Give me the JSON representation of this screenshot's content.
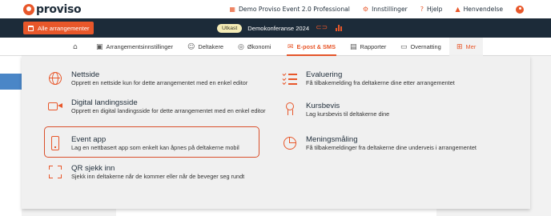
{
  "brand": {
    "name": "proviso",
    "accent": "#e8572a",
    "dark": "#1c2b39"
  },
  "topbar": {
    "product": "Demo Proviso Event 2.0 Professional",
    "settings": "Innstillinger",
    "help": "Hjelp",
    "notifications": "Henvendelse"
  },
  "eventbar": {
    "all_events": "Alle arrangementer",
    "status": "Utkast",
    "event_name": "Demokonferanse 2024"
  },
  "nav": {
    "home": "",
    "event_settings": "Arrangementsinnstillinger",
    "participants": "Deltakere",
    "economy": "Økonomi",
    "email_sms": "E-post & SMS",
    "reports": "Rapporter",
    "overnight": "Overnatting",
    "more": "Mer"
  },
  "menu": {
    "left": [
      {
        "title": "Nettside",
        "desc": "Opprett en nettside kun for dette arrangementet med en enkel editor",
        "icon": "globe-icon"
      },
      {
        "title": "Digital landingsside",
        "desc": "Opprett en digital landingsside for dette arrangementet med en enkel editor",
        "icon": "video-icon"
      },
      {
        "title": "Event app",
        "desc": "Lag en nettbasert app som enkelt kan åpnes på deltakerne mobil",
        "icon": "phone-icon"
      },
      {
        "title": "QR sjekk inn",
        "desc": "Sjekk inn deltakerne når de kommer eller når de beveger seg rundt",
        "icon": "qr-scan-icon"
      }
    ],
    "right": [
      {
        "title": "Evaluering",
        "desc": "Få tilbakemelding fra deltakerne dine etter arrangementet",
        "icon": "checklist-icon"
      },
      {
        "title": "Kursbevis",
        "desc": "Lag kursbevis til deltakerne dine",
        "icon": "certificate-icon"
      },
      {
        "title": "Meningsmåling",
        "desc": "Få tilbakemeldinger fra deltakerne dine underveis i arrangementet",
        "icon": "pie-chart-icon"
      }
    ]
  }
}
